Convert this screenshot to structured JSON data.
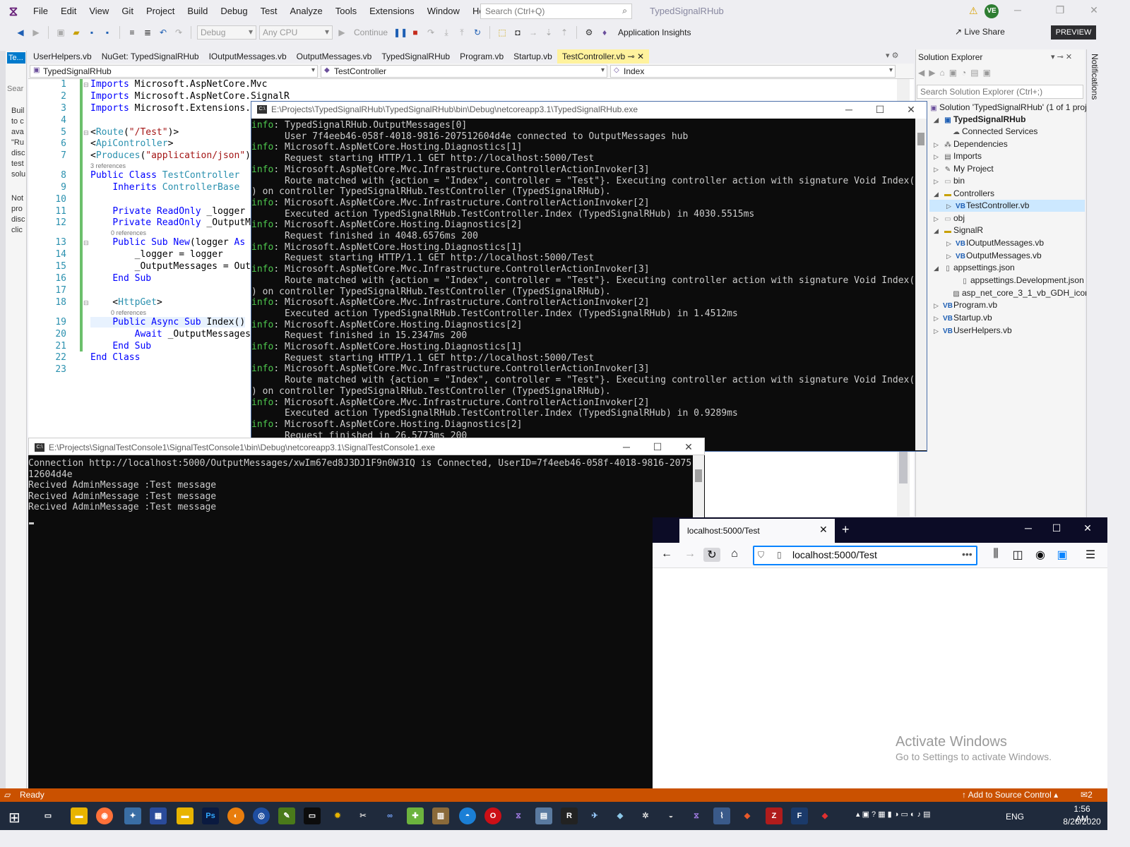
{
  "menubar": {
    "items": [
      "File",
      "Edit",
      "View",
      "Git",
      "Project",
      "Build",
      "Debug",
      "Test",
      "Analyze",
      "Tools",
      "Extensions",
      "Window",
      "Help"
    ],
    "search_placeholder": "Search (Ctrl+Q)",
    "solution_title": "TypedSignalRHub",
    "avatar_initials": "VE"
  },
  "toolbar": {
    "config": "Debug",
    "platform": "Any CPU",
    "continue_label": "Continue",
    "app_insights": "Application Insights",
    "live_share": "Live Share",
    "preview": "PREVIEW"
  },
  "toolbox": {
    "tab": "Te...",
    "search": "Sear",
    "lines": [
      "Buil",
      "to c",
      "ava",
      "\"Ru",
      "disc",
      "test",
      "solu",
      "",
      "Not",
      "pro",
      "disc",
      "clic"
    ]
  },
  "doc_tabs": [
    "UserHelpers.vb",
    "NuGet: TypedSignalRHub",
    "IOutputMessages.vb",
    "OutputMessages.vb",
    "TypedSignalRHub",
    "Program.vb",
    "Startup.vb",
    "TestController.vb"
  ],
  "navbar": {
    "project": "TypedSignalRHub",
    "class": "TestController",
    "member": "Index"
  },
  "editor": {
    "line_numbers": [
      "1",
      "2",
      "3",
      "4",
      "5",
      "6",
      "7",
      "8",
      "9",
      "10",
      "11",
      "12",
      "13",
      "14",
      "15",
      "16",
      "17",
      "18",
      "19",
      "20",
      "21",
      "22",
      "23"
    ],
    "refs_3": "3 references",
    "refs_0a": "0 references",
    "refs_0b": "0 references"
  },
  "solution_explorer": {
    "title": "Solution Explorer",
    "search_placeholder": "Search Solution Explorer (Ctrl+;)",
    "items": [
      "Solution 'TypedSignalRHub' (1 of 1 proje",
      "TypedSignalRHub",
      "Connected Services",
      "Dependencies",
      "Imports",
      "My Project",
      "bin",
      "Controllers",
      "TestController.vb",
      "obj",
      "SignalR",
      "IOutputMessages.vb",
      "OutputMessages.vb",
      "appsettings.json",
      "appsettings.Development.json",
      "asp_net_core_3_1_vb_GDH_icon.ic",
      "Program.vb",
      "Startup.vb",
      "UserHelpers.vb"
    ]
  },
  "notifications_label": "Notifications",
  "console_server": {
    "title": "E:\\Projects\\TypedSignalRHub\\TypedSignalRHub\\bin\\Debug\\netcoreapp3.1\\TypedSignalRHub.exe",
    "lines": [
      [
        "info",
        ": TypedSignalRHub.OutputMessages[0]"
      ],
      [
        "",
        "      User 7f4eeb46-058f-4018-9816-207512604d4e connected to OutputMessages hub"
      ],
      [
        "info",
        ": Microsoft.AspNetCore.Hosting.Diagnostics[1]"
      ],
      [
        "",
        "      Request starting HTTP/1.1 GET http://localhost:5000/Test"
      ],
      [
        "info",
        ": Microsoft.AspNetCore.Mvc.Infrastructure.ControllerActionInvoker[3]"
      ],
      [
        "",
        "      Route matched with {action = \"Index\", controller = \"Test\"}. Executing controller action with signature Void Index("
      ],
      [
        "",
        ") on controller TypedSignalRHub.TestController (TypedSignalRHub)."
      ],
      [
        "info",
        ": Microsoft.AspNetCore.Mvc.Infrastructure.ControllerActionInvoker[2]"
      ],
      [
        "",
        "      Executed action TypedSignalRHub.TestController.Index (TypedSignalRHub) in 4030.5515ms"
      ],
      [
        "info",
        ": Microsoft.AspNetCore.Hosting.Diagnostics[2]"
      ],
      [
        "",
        "      Request finished in 4048.6576ms 200"
      ],
      [
        "info",
        ": Microsoft.AspNetCore.Hosting.Diagnostics[1]"
      ],
      [
        "",
        "      Request starting HTTP/1.1 GET http://localhost:5000/Test"
      ],
      [
        "info",
        ": Microsoft.AspNetCore.Mvc.Infrastructure.ControllerActionInvoker[3]"
      ],
      [
        "",
        "      Route matched with {action = \"Index\", controller = \"Test\"}. Executing controller action with signature Void Index("
      ],
      [
        "",
        ") on controller TypedSignalRHub.TestController (TypedSignalRHub)."
      ],
      [
        "info",
        ": Microsoft.AspNetCore.Mvc.Infrastructure.ControllerActionInvoker[2]"
      ],
      [
        "",
        "      Executed action TypedSignalRHub.TestController.Index (TypedSignalRHub) in 1.4512ms"
      ],
      [
        "info",
        ": Microsoft.AspNetCore.Hosting.Diagnostics[2]"
      ],
      [
        "",
        "      Request finished in 15.2347ms 200"
      ],
      [
        "info",
        ": Microsoft.AspNetCore.Hosting.Diagnostics[1]"
      ],
      [
        "",
        "      Request starting HTTP/1.1 GET http://localhost:5000/Test"
      ],
      [
        "info",
        ": Microsoft.AspNetCore.Mvc.Infrastructure.ControllerActionInvoker[3]"
      ],
      [
        "",
        "      Route matched with {action = \"Index\", controller = \"Test\"}. Executing controller action with signature Void Index("
      ],
      [
        "",
        ") on controller TypedSignalRHub.TestController (TypedSignalRHub)."
      ],
      [
        "info",
        ": Microsoft.AspNetCore.Mvc.Infrastructure.ControllerActionInvoker[2]"
      ],
      [
        "",
        "      Executed action TypedSignalRHub.TestController.Index (TypedSignalRHub) in 0.9289ms"
      ],
      [
        "info",
        ": Microsoft.AspNetCore.Hosting.Diagnostics[2]"
      ],
      [
        "",
        "      Request finished in 26.5773ms 200"
      ]
    ]
  },
  "console_client": {
    "title": "E:\\Projects\\SignalTestConsole1\\SignalTestConsole1\\bin\\Debug\\netcoreapp3.1\\SignalTestConsole1.exe",
    "lines": [
      "Connection http://localhost:5000/OutputMessages/xwIm67ed8J3DJ1F9n0W3IQ is Connected, UserID=7f4eeb46-058f-4018-9816-2075",
      "12604d4e",
      "Recived AdminMessage :Test message",
      "Recived AdminMessage :Test message",
      "Recived AdminMessage :Test message"
    ]
  },
  "firefox": {
    "tab_title": "localhost:5000/Test",
    "url": "localhost:5000/Test",
    "watermark_1": "Activate Windows",
    "watermark_2": "Go to Settings to activate Windows."
  },
  "statusbar": {
    "status": "Ready",
    "source_control": "Add to Source Control",
    "notif_count": "2"
  },
  "taskbar": {
    "lang": "ENG",
    "time": "1:56 AM",
    "date": "8/26/2020"
  }
}
